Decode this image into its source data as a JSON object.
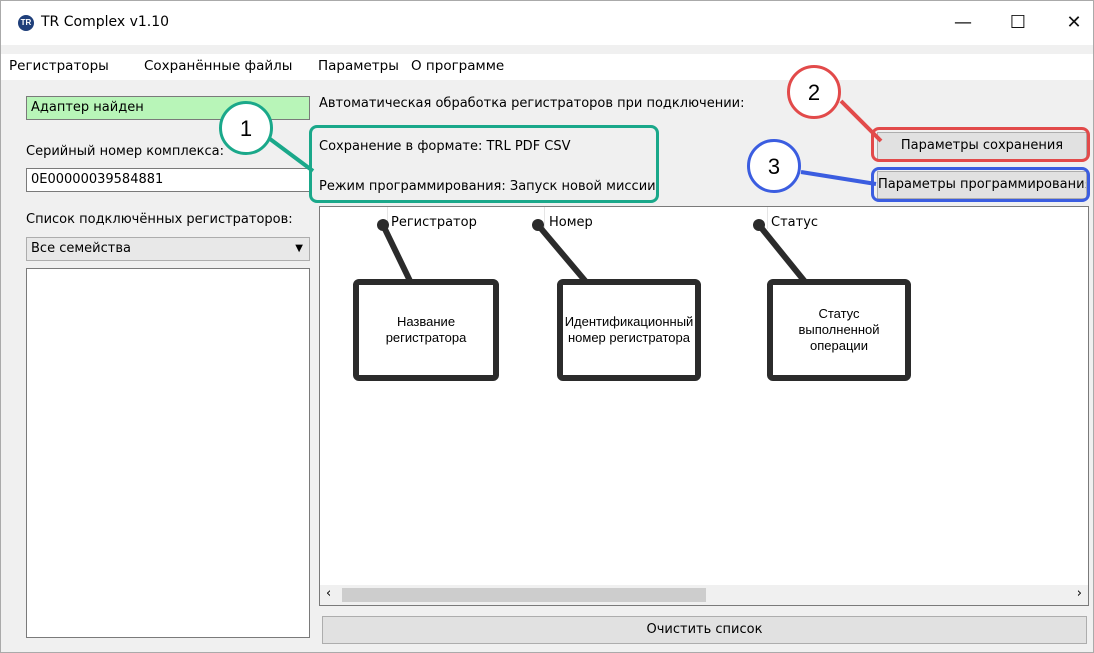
{
  "window": {
    "title": "TR Complex v1.10",
    "icon_text": "TR",
    "controls": {
      "minimize": "—",
      "maximize": "☐",
      "close": "✕"
    }
  },
  "menu": [
    "Регистраторы",
    "Сохранённые файлы",
    "Параметры",
    "О программе"
  ],
  "left_panel": {
    "adapter_status": "Адаптер найден",
    "adapter_status_color": "#b8f5b8",
    "serial_label": "Серийный номер комплекса:",
    "serial_value": "0E00000039584881",
    "registrators_label": "Список подключённых регистраторов:",
    "family_filter": "Все семейства"
  },
  "right_panel": {
    "auto_processing_label": "Автоматическая обработка регистраторов при подключении:",
    "save_format": "Сохранение в формате: TRL PDF CSV",
    "programming_mode": "Режим программирования: Запуск новой миссии",
    "save_params_button": "Параметры сохранения",
    "programming_params_button": "Параметры программирования",
    "columns": [
      "Регистратор",
      "Номер",
      "Статус"
    ],
    "clear_button": "Очистить список"
  },
  "annotations": {
    "markers": [
      {
        "number": "1",
        "color": "#1aa88a"
      },
      {
        "number": "2",
        "color": "#e24a4a"
      },
      {
        "number": "3",
        "color": "#3b5de0"
      }
    ],
    "callouts": [
      "Название регистратора",
      "Идентификационный номер регистратора",
      "Статус выполненной операции"
    ],
    "callout_color": "#2b2b2b"
  }
}
